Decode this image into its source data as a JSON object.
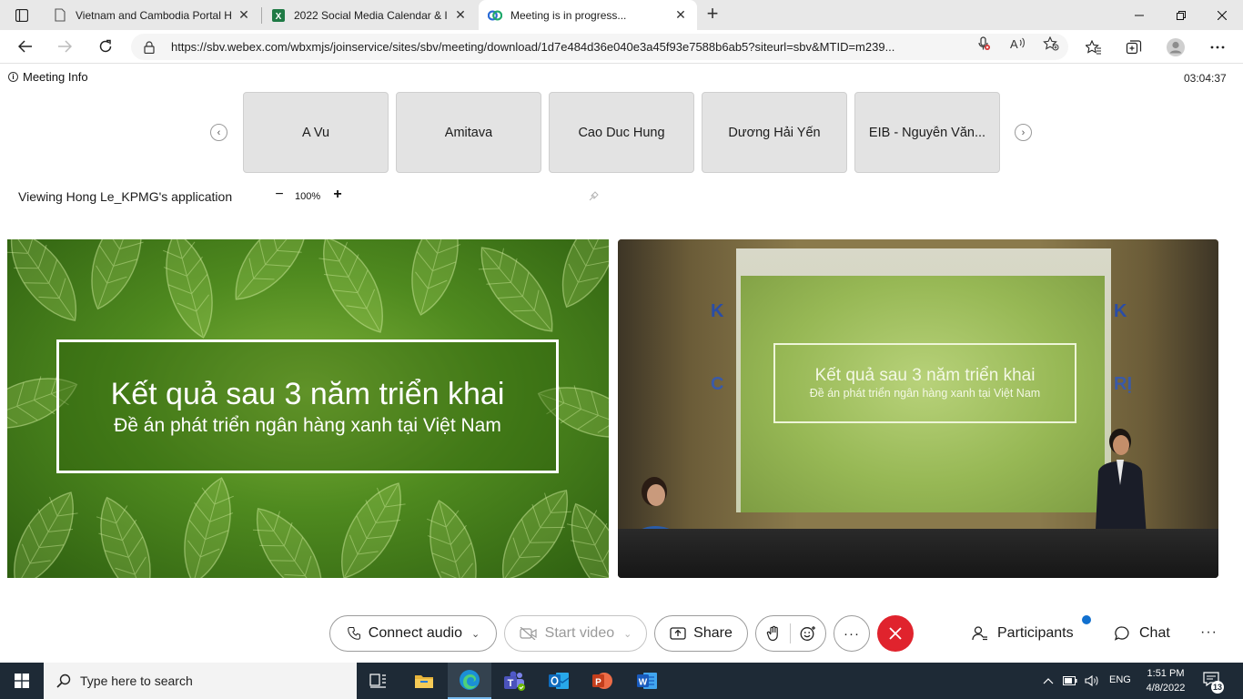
{
  "browser": {
    "tabs": [
      {
        "title": "Vietnam and Cambodia Portal H",
        "active": false
      },
      {
        "title": "2022 Social Media Calendar & In",
        "active": false
      },
      {
        "title": "Meeting is in progress...",
        "active": true
      }
    ],
    "url": "https://sbv.webex.com/wbxmjs/joinservice/sites/sbv/meeting/download/1d7e484d36e040e3a45f93e7588b6ab5?siteurl=sbv&MTID=m239..."
  },
  "meeting": {
    "info_label": "Meeting Info",
    "timer": "03:04:37",
    "participants_strip": [
      "A Vu",
      "Amitava",
      "Cao Duc Hung",
      "Dương Hải Yến",
      "EIB - Nguyễn Văn..."
    ],
    "viewing_label": "Viewing Hong Le_KPMG's application",
    "zoom": {
      "minus": "−",
      "value": "100%",
      "plus": "+"
    },
    "slide": {
      "title": "Kết quả sau 3 năm triển khai",
      "subtitle": "Đề án phát triển ngân hàng xanh tại Việt Nam"
    }
  },
  "controls": {
    "connect_audio": "Connect audio",
    "start_video": "Start video",
    "share": "Share",
    "participants": "Participants",
    "chat": "Chat",
    "more": "···"
  },
  "taskbar": {
    "search_placeholder": "Type here to search",
    "language": "ENG",
    "time": "1:51 PM",
    "date": "4/8/2022",
    "notification_count": "13"
  },
  "colors": {
    "end_button": "#e0232d",
    "taskbar": "#1e2a36",
    "notification_dot": "#1170cf"
  }
}
